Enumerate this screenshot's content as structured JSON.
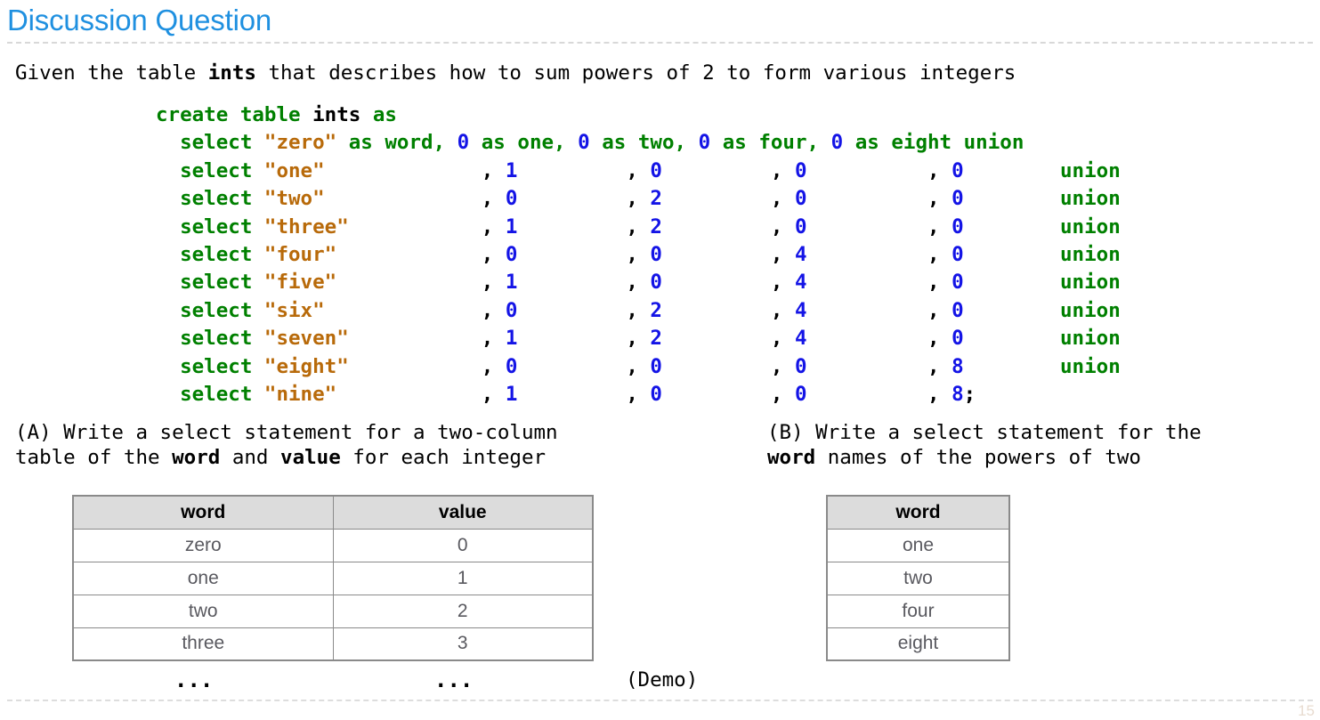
{
  "title": "Discussion Question",
  "intro": {
    "before": "Given the table ",
    "table_name": "ints",
    "after": " that describes how to sum powers of 2 to form various integers"
  },
  "code": {
    "header": {
      "create": "create table ",
      "name": "ints",
      "as": " as"
    },
    "select_keyword": "select",
    "first_row": {
      "word": "\"zero\"",
      "as_word": " as word, ",
      "one": "0",
      "as_one": " as one, ",
      "two": "0",
      "as_two": " as two, ",
      "four": "0",
      "as_four": " as four, ",
      "eight": "0",
      "as_eight": " as eight ",
      "union": "union"
    },
    "rows": [
      {
        "word": "\"one\"",
        "one": "1",
        "two": "0",
        "four": "0",
        "eight": "0",
        "tail": "union"
      },
      {
        "word": "\"two\"",
        "one": "0",
        "two": "2",
        "four": "0",
        "eight": "0",
        "tail": "union"
      },
      {
        "word": "\"three\"",
        "one": "1",
        "two": "2",
        "four": "0",
        "eight": "0",
        "tail": "union"
      },
      {
        "word": "\"four\"",
        "one": "0",
        "two": "0",
        "four": "4",
        "eight": "0",
        "tail": "union"
      },
      {
        "word": "\"five\"",
        "one": "1",
        "two": "0",
        "four": "4",
        "eight": "0",
        "tail": "union"
      },
      {
        "word": "\"six\"",
        "one": "0",
        "two": "2",
        "four": "4",
        "eight": "0",
        "tail": "union"
      },
      {
        "word": "\"seven\"",
        "one": "1",
        "two": "2",
        "four": "4",
        "eight": "0",
        "tail": "union"
      },
      {
        "word": "\"eight\"",
        "one": "0",
        "two": "0",
        "four": "0",
        "eight": "8",
        "tail": "union"
      },
      {
        "word": "\"nine\"",
        "one": "1",
        "two": "0",
        "four": "0",
        "eight": "8",
        "tail": ";"
      }
    ],
    "comma": ",",
    "semicolon": ";",
    "colors": {
      "keyword": "#008000",
      "identifier": "#000000",
      "string": "#b86a0a",
      "number": "#1414e6"
    }
  },
  "questions": {
    "a": {
      "line1": "(A) Write a select statement for a two-column",
      "line2_before": "table of the ",
      "line2_bold1": "word",
      "line2_mid": " and ",
      "line2_bold2": "value",
      "line2_after": " for each integer"
    },
    "b": {
      "line1": "(B) Write a select statement for the",
      "line2_bold1": "word",
      "line2_after": " names of the powers of two"
    }
  },
  "table_a": {
    "headers": [
      "word",
      "value"
    ],
    "rows": [
      [
        "zero",
        "0"
      ],
      [
        "one",
        "1"
      ],
      [
        "two",
        "2"
      ],
      [
        "three",
        "3"
      ]
    ],
    "ellipsis_word": "...",
    "ellipsis_value": "..."
  },
  "table_b": {
    "headers": [
      "word"
    ],
    "rows": [
      [
        "one"
      ],
      [
        "two"
      ],
      [
        "four"
      ],
      [
        "eight"
      ]
    ]
  },
  "demo_label": "(Demo)",
  "page_number": "15",
  "theme": {
    "title_color": "#1f90e0",
    "rule_color": "#d8d8d8",
    "table_header_bg": "#dcdcdc",
    "table_border": "#8a8a8a",
    "table_text": "#59595f"
  }
}
